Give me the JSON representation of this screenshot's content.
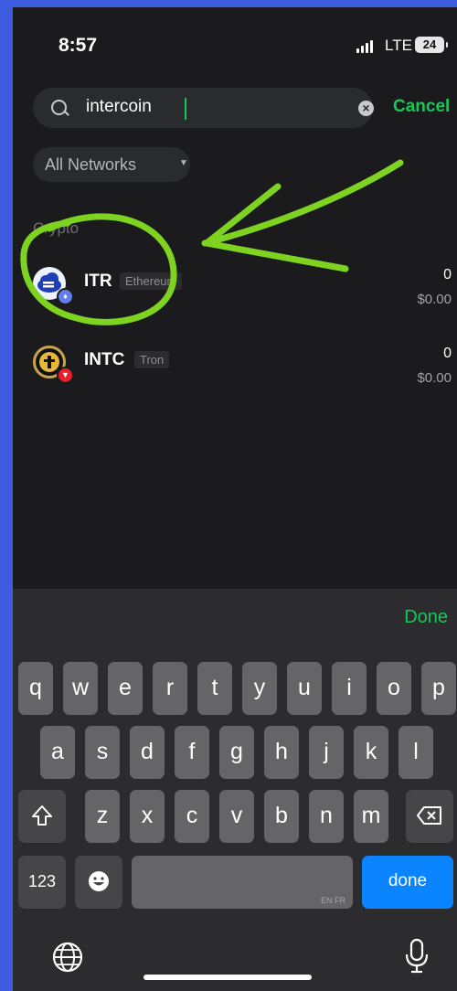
{
  "status": {
    "time": "8:57",
    "network": "LTE",
    "battery": "24"
  },
  "search": {
    "value": "intercoin",
    "cancel": "Cancel"
  },
  "filter": {
    "label": "All Networks"
  },
  "section": {
    "label": "Crypto"
  },
  "tokens": [
    {
      "symbol": "ITR",
      "network": "Ethereum",
      "amount": "0",
      "fiat": "$0.00"
    },
    {
      "symbol": "INTC",
      "network": "Tron",
      "amount": "0",
      "fiat": "$0.00"
    }
  ],
  "keyboard": {
    "done_bar": "Done",
    "row1": [
      "q",
      "w",
      "e",
      "r",
      "t",
      "y",
      "u",
      "i",
      "o",
      "p"
    ],
    "row2": [
      "a",
      "s",
      "d",
      "f",
      "g",
      "h",
      "j",
      "k",
      "l"
    ],
    "row3": [
      "z",
      "x",
      "c",
      "v",
      "b",
      "n",
      "m"
    ],
    "numbers": "123",
    "space_lang": "EN FR",
    "return": "done"
  },
  "colors": {
    "accent": "#18c65a",
    "annotation": "#7ed321",
    "background": "#1b1b1d",
    "frame": "#3d5ce0"
  }
}
